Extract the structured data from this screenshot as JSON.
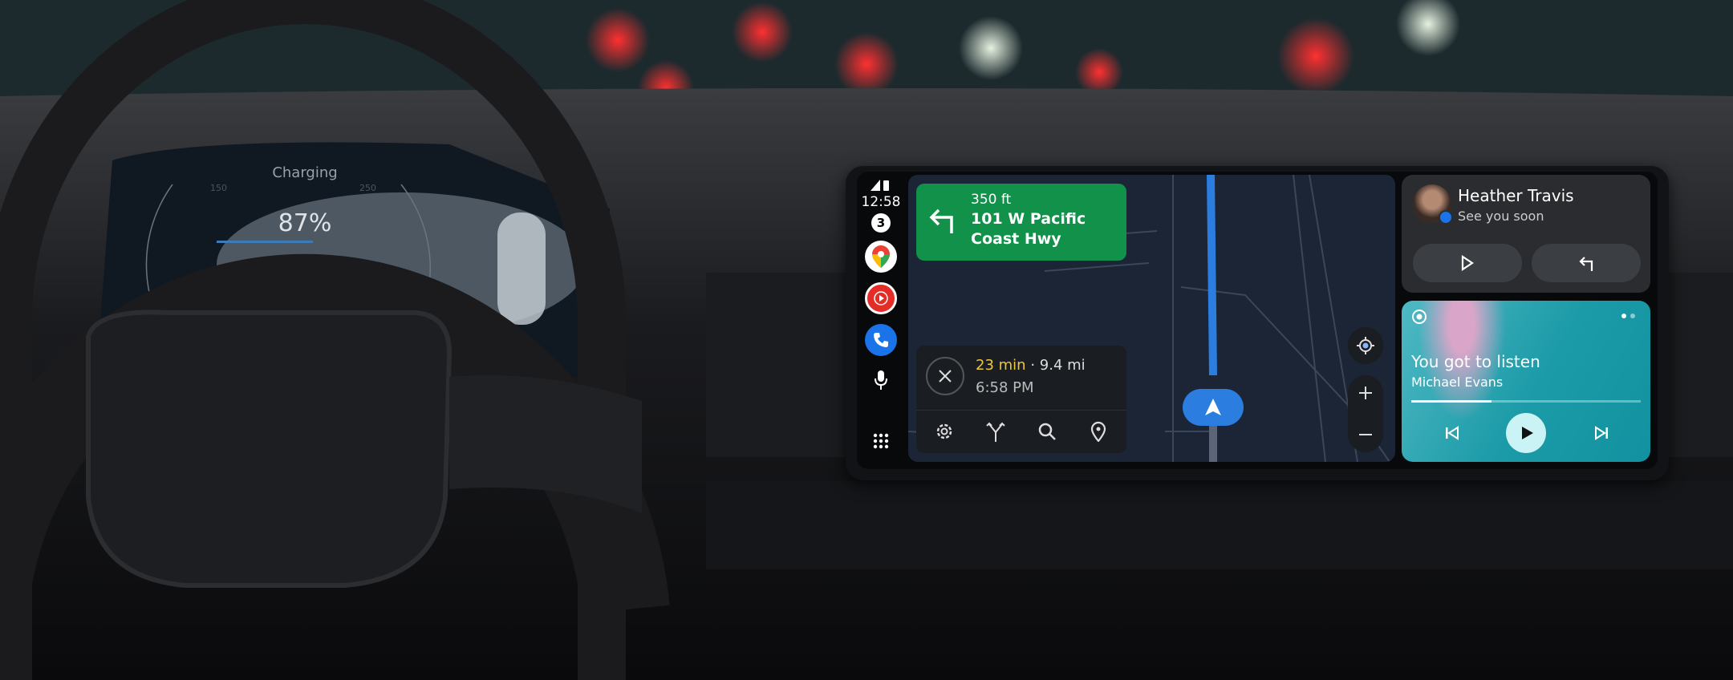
{
  "cluster": {
    "status": "Charging",
    "battery": "87%",
    "battery_level": 0.87,
    "scale_left": "150",
    "scale_right": "250"
  },
  "rail": {
    "time": "12:58",
    "notification_count": "3",
    "apps": [
      {
        "name": "Google Maps",
        "icon": "maps-icon"
      },
      {
        "name": "YouTube Music",
        "icon": "youtube-music-icon",
        "color": "#e52d27"
      },
      {
        "name": "Phone",
        "icon": "phone-icon",
        "color": "#1a73e8"
      }
    ]
  },
  "navigation": {
    "distance": "350 ft",
    "street": "101 W Pacific Coast Hwy",
    "eta_duration": "23 min",
    "separator": "·",
    "eta_distance": "9.4 mi",
    "arrival_time": "6:58 PM",
    "turn_color": "#12914a",
    "route_color": "#2b7de0"
  },
  "message": {
    "sender": "Heather Travis",
    "text": "See you soon"
  },
  "media": {
    "title": "You got to listen",
    "artist": "Michael Evans",
    "progress": 0.35
  }
}
